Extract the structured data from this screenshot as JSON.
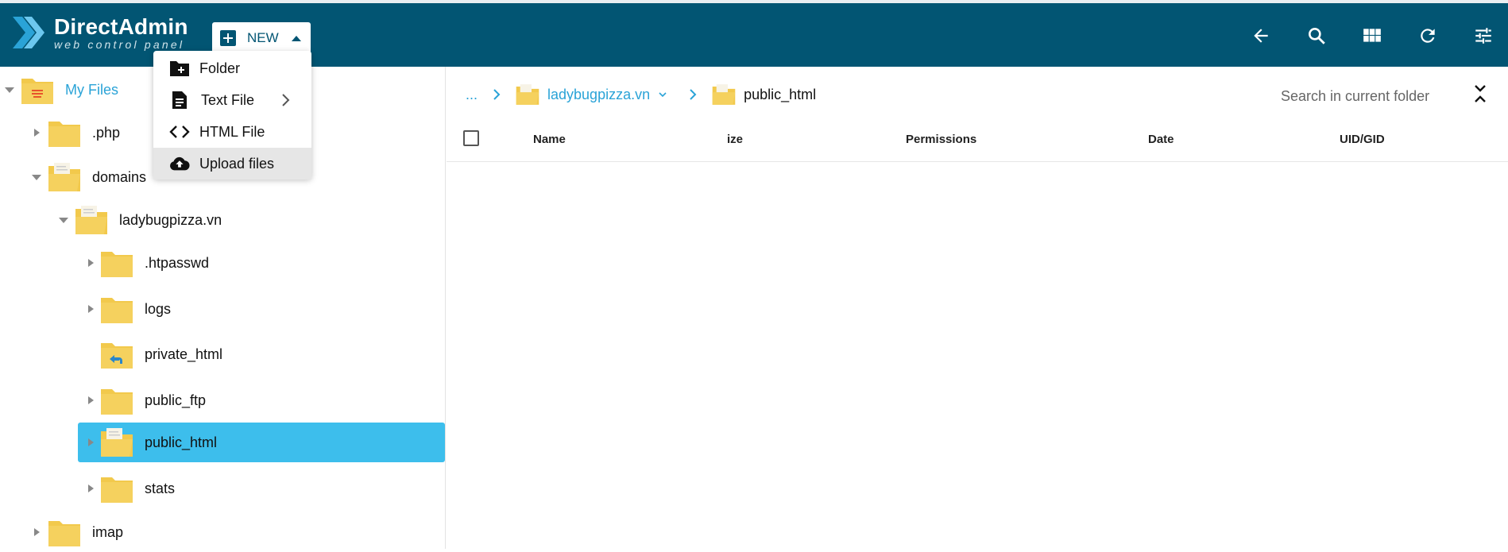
{
  "app": {
    "title": "DirectAdmin",
    "subtitle": "web control panel"
  },
  "toolbar": {
    "new_label": "NEW",
    "icons": [
      "arrow-back-icon",
      "search-icon",
      "grid-view-icon",
      "refresh-icon",
      "settings-sliders-icon"
    ]
  },
  "new_menu": {
    "items": [
      {
        "label": "Folder",
        "icon": "new-folder-icon"
      },
      {
        "label": "Text File",
        "icon": "text-file-icon",
        "has_submenu": true
      },
      {
        "label": "HTML File",
        "icon": "code-icon"
      },
      {
        "label": "Upload files",
        "icon": "cloud-upload-icon",
        "highlighted": true
      }
    ]
  },
  "tree": {
    "root": "My Files",
    "items": [
      {
        "label": ".php"
      },
      {
        "label": "domains"
      },
      {
        "label": "ladybugpizza.vn"
      },
      {
        "label": ".htpasswd"
      },
      {
        "label": "logs"
      },
      {
        "label": "private_html"
      },
      {
        "label": "public_ftp"
      },
      {
        "label": "public_html",
        "selected": true
      },
      {
        "label": "stats"
      },
      {
        "label": "imap"
      }
    ]
  },
  "breadcrumb": {
    "ellipsis": "...",
    "domain": "ladybugpizza.vn",
    "current": "public_html"
  },
  "search": {
    "placeholder": "Search in current folder"
  },
  "table": {
    "columns": [
      "Name",
      "ize",
      "Permissions",
      "Date",
      "UID/GID"
    ]
  },
  "colors": {
    "header": "#025573",
    "accent": "#2aa3d7",
    "selected": "#3dbeec",
    "folder": "#f2c94c"
  }
}
